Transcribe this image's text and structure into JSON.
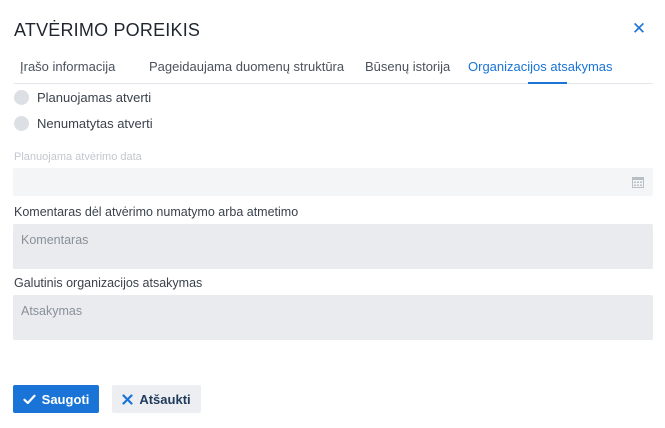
{
  "dialog": {
    "title": "ATVĖRIMO POREIKIS",
    "close_icon": "close-icon"
  },
  "tabs": [
    {
      "label": "Įrašo informacija",
      "active": false
    },
    {
      "label": "Pageidaujama duomenų struktūra",
      "active": false
    },
    {
      "label": "Būsenų istorija",
      "active": false
    },
    {
      "label": "Organizacijos atsakymas",
      "active": true
    }
  ],
  "radios": [
    {
      "label": "Planuojamas atverti",
      "checked": false
    },
    {
      "label": "Nenumatytas atverti",
      "checked": false
    }
  ],
  "date_field": {
    "label": "Planuojama atvėrimo data",
    "value": "",
    "disabled": true,
    "icon": "calendar-icon"
  },
  "comment_field": {
    "label": "Komentaras dėl atvėrimo numatymo arba atmetimo",
    "placeholder": "Komentaras"
  },
  "answer_field": {
    "label": "Galutinis organizacijos atsakymas",
    "placeholder": "Atsakymas"
  },
  "buttons": {
    "save_label": "Saugoti",
    "cancel_label": "Atšaukti"
  },
  "colors": {
    "accent": "#1a73d6",
    "input_bg": "#e9ebef",
    "disabled_bg": "#f4f5f7"
  }
}
